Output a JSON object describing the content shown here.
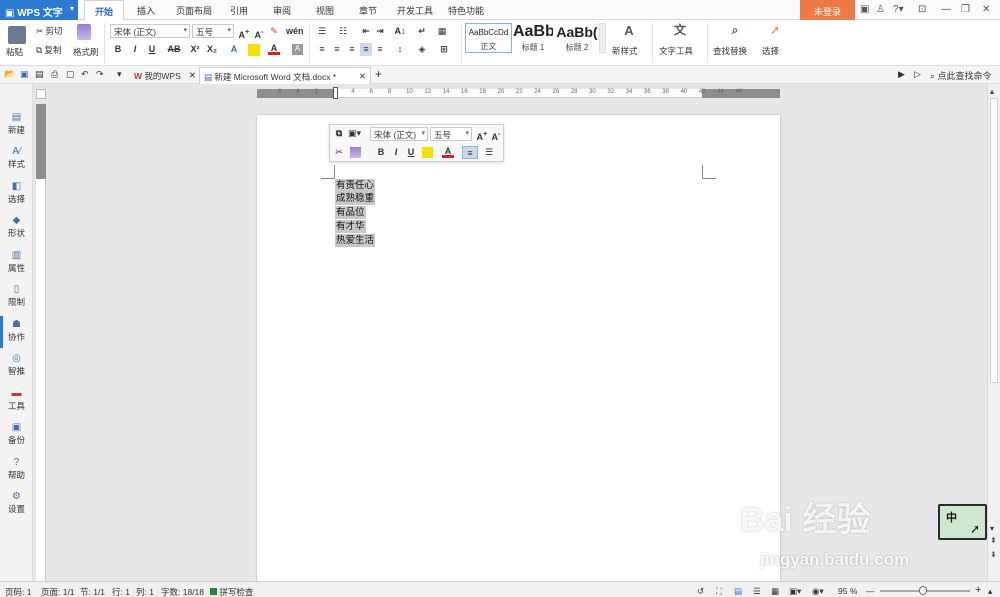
{
  "titlebar": {
    "app_button": "WPS 文字",
    "tabs": [
      "开始",
      "插入",
      "页面布局",
      "引用",
      "审阅",
      "视图",
      "章节",
      "开发工具",
      "特色功能"
    ],
    "login": "未登录",
    "help": "?"
  },
  "ribbon": {
    "paste": "粘贴",
    "cut": "剪切",
    "copy": "复制",
    "format_painter": "格式刷",
    "font_name": "宋体 (正文)",
    "font_size": "五号",
    "styles": [
      {
        "preview": "AaBbCcDd",
        "name": "正文"
      },
      {
        "preview": "AaBb",
        "name": "标题 1"
      },
      {
        "preview": "AaBb(",
        "name": "标题 2"
      }
    ],
    "new_style": "新样式",
    "text_tools": "文字工具",
    "find_replace": "查找替换",
    "select": "选择"
  },
  "quickbar": {
    "tab_home": "我的WPS",
    "tab_doc": "新建 Microsoft Word 文档.docx *",
    "add_tab": "+",
    "search_cmd": "点此查找命令"
  },
  "sidebar": {
    "items": [
      {
        "label": "新建",
        "icon": "new-doc-icon"
      },
      {
        "label": "样式",
        "icon": "style-icon"
      },
      {
        "label": "选择",
        "icon": "select-icon"
      },
      {
        "label": "形状",
        "icon": "shape-icon"
      },
      {
        "label": "属性",
        "icon": "properties-icon"
      },
      {
        "label": "限制",
        "icon": "restrict-icon"
      },
      {
        "label": "协作",
        "icon": "collab-icon"
      },
      {
        "label": "智推",
        "icon": "smart-icon"
      },
      {
        "label": "工具",
        "icon": "toolbox-icon"
      },
      {
        "label": "备份",
        "icon": "backup-icon"
      },
      {
        "label": "帮助",
        "icon": "help-icon"
      },
      {
        "label": "设置",
        "icon": "settings-icon"
      }
    ]
  },
  "ruler": {
    "numbers": [
      "6",
      "4",
      "2",
      "2",
      "4",
      "6",
      "8",
      "10",
      "12",
      "14",
      "16",
      "18",
      "20",
      "22",
      "24",
      "26",
      "28",
      "30",
      "32",
      "34",
      "36",
      "38",
      "40",
      "42",
      "44",
      "46"
    ]
  },
  "mini_toolbar": {
    "font_name": "宋体 (正文)",
    "font_size": "五号"
  },
  "document": {
    "lines": [
      "有责任心",
      "成熟稳重",
      "有品位",
      "有才华",
      "热爱生活"
    ]
  },
  "status": {
    "page_num": "页码: 1",
    "pages": "页面: 1/1",
    "section": "节: 1/1",
    "row": "行: 1",
    "col": "列: 1",
    "words": "字数: 18/18",
    "spell": "拼写检查",
    "zoom": "95 %"
  },
  "watermark": {
    "brand": "Bai  经验",
    "url": "jingyan.baidu.com"
  },
  "ime": {
    "label": "中"
  },
  "colors": {
    "app_blue": "#2b79d0",
    "login_orange": "#ee7947",
    "selection_gray": "#c8c8c8",
    "font_color_red": "#e02020",
    "highlight_yellow": "#f5e000"
  }
}
